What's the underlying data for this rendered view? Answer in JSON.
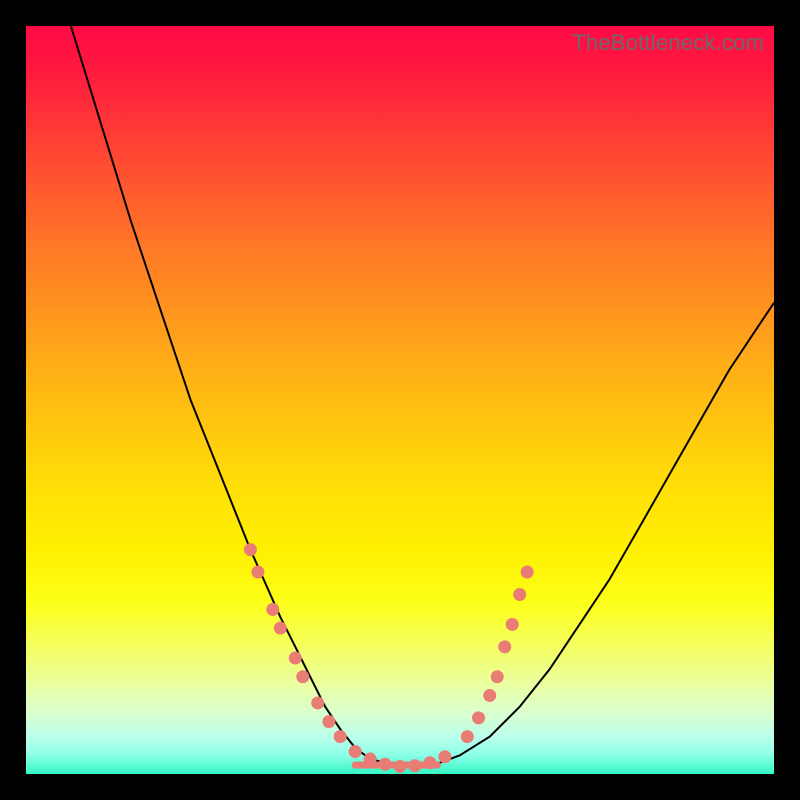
{
  "watermark": "TheBottleneck.com",
  "colors": {
    "dot": "#e97c74",
    "curve": "#000000",
    "frame_bg_top": "#ff0a46",
    "frame_bg_bottom": "#34f7c4",
    "page_bg": "#000000"
  },
  "chart_data": {
    "type": "line",
    "title": "",
    "xlabel": "",
    "ylabel": "",
    "xlim": [
      0,
      100
    ],
    "ylim": [
      0,
      100
    ],
    "series": [
      {
        "name": "bottleneck-curve",
        "x": [
          6,
          10,
          14,
          18,
          22,
          26,
          30,
          34,
          36,
          38,
          40,
          42,
          44,
          46,
          50,
          54,
          58,
          62,
          66,
          70,
          74,
          78,
          82,
          86,
          90,
          94,
          98,
          100
        ],
        "y": [
          100,
          87,
          74,
          62,
          50,
          40,
          30,
          21,
          17,
          13,
          9,
          6,
          3.5,
          2,
          1,
          1,
          2.5,
          5,
          9,
          14,
          20,
          26,
          33,
          40,
          47,
          54,
          60,
          63
        ]
      }
    ],
    "highlighted_points": {
      "left_cluster": [
        {
          "x": 30,
          "y": 30
        },
        {
          "x": 31,
          "y": 27
        },
        {
          "x": 33,
          "y": 22
        },
        {
          "x": 34,
          "y": 19.5
        },
        {
          "x": 36,
          "y": 15.5
        },
        {
          "x": 37,
          "y": 13
        },
        {
          "x": 39,
          "y": 9.5
        },
        {
          "x": 40.5,
          "y": 7
        }
      ],
      "valley": [
        {
          "x": 42,
          "y": 5
        },
        {
          "x": 44,
          "y": 3
        },
        {
          "x": 46,
          "y": 2
        },
        {
          "x": 48,
          "y": 1.3
        },
        {
          "x": 50,
          "y": 1
        },
        {
          "x": 52,
          "y": 1.1
        },
        {
          "x": 54,
          "y": 1.5
        },
        {
          "x": 56,
          "y": 2.3
        }
      ],
      "right_cluster": [
        {
          "x": 59,
          "y": 5
        },
        {
          "x": 60.5,
          "y": 7.5
        },
        {
          "x": 62,
          "y": 10.5
        },
        {
          "x": 63,
          "y": 13
        },
        {
          "x": 64,
          "y": 17
        },
        {
          "x": 65,
          "y": 20
        },
        {
          "x": 66,
          "y": 24
        },
        {
          "x": 67,
          "y": 27
        }
      ]
    },
    "flat_segment": {
      "x0": 44,
      "x1": 55,
      "y": 1.2
    }
  }
}
